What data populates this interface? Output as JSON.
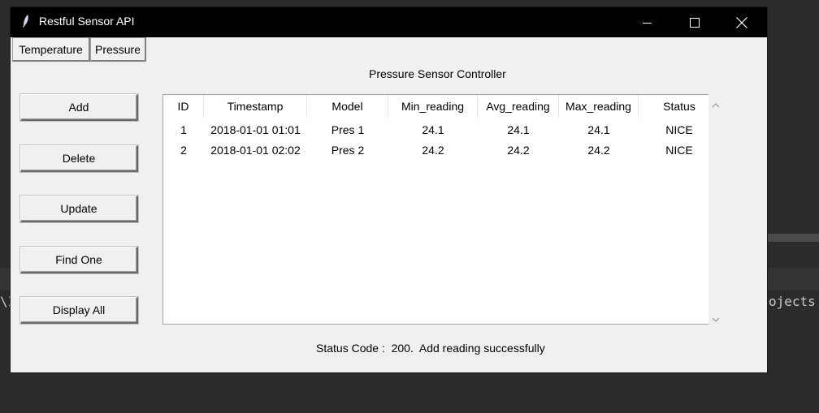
{
  "window": {
    "title": "Restful Sensor API"
  },
  "tabs": [
    "Temperature",
    "Pressure"
  ],
  "heading": "Pressure Sensor Controller",
  "buttons": {
    "add": "Add",
    "delete": "Delete",
    "update": "Update",
    "find_one": "Find One",
    "display_all": "Display All"
  },
  "table": {
    "columns": [
      "ID",
      "Timestamp",
      "Model",
      "Min_reading",
      "Avg_reading",
      "Max_reading",
      "Status"
    ],
    "rows": [
      [
        "1",
        "2018-01-01 01:01",
        "Pres 1",
        "24.1",
        "24.1",
        "24.1",
        "NICE"
      ],
      [
        "2",
        "2018-01-01 02:02",
        "Pres 2",
        "24.2",
        "24.2",
        "24.2",
        "NICE"
      ]
    ]
  },
  "status_text": "Status Code :  200.  Add reading successfully",
  "background": {
    "left_text": "\\I",
    "right_text": "ojects"
  },
  "colors": {
    "titlebar": "#000000",
    "window_bg": "#f0f0f0",
    "desktop_bg": "#2b2b29"
  }
}
